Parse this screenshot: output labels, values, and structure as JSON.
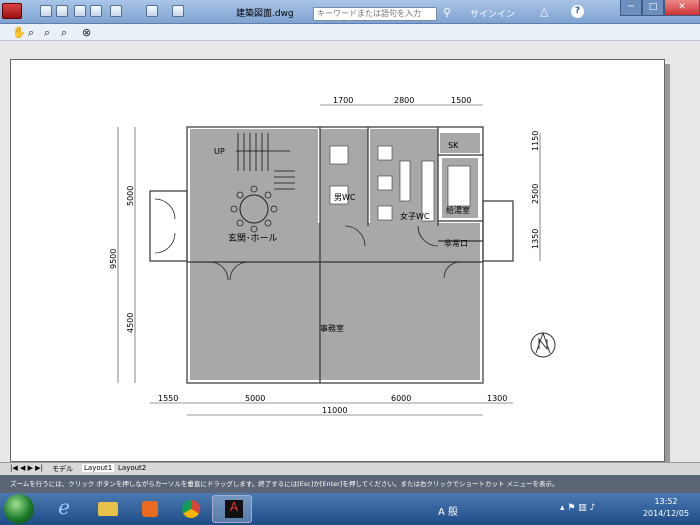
{
  "title_bar": {
    "file_name": "建築図面.dwg",
    "search_placeholder": "キーワードまたは語句を入力",
    "signin": "サインイン"
  },
  "toolbar_icons": [
    "pan-icon",
    "zoom-realtime-icon",
    "zoom-window-icon",
    "zoom-previous-icon",
    "close-icon"
  ],
  "layout_tabs": [
    "モデル",
    "Layout1",
    "Layout2"
  ],
  "command_line": "ズームを行うには、クリック ボタンを押しながらカーソルを垂直にドラッグします。終了するには[Esc]か[Enter]を押してください。または右クリックでショートカット メニューを表示。",
  "drawing": {
    "top_dims": [
      "1700",
      "2800",
      "1500"
    ],
    "bottom_dims": [
      "1550",
      "5000",
      "6000",
      "1300"
    ],
    "total_width": "11000",
    "left_dims": [
      "5000",
      "9500",
      "4500"
    ],
    "right_dims": [
      "1150",
      "2500",
      "1350"
    ],
    "rooms": {
      "up": "UP",
      "hall": "玄関･ホール",
      "mens_wc": "男WC",
      "womens_wc": "女子WC",
      "kitchenette": "給湯室",
      "sk": "SK",
      "emergency_exit": "非常口",
      "office": "事務室"
    }
  },
  "taskbar": {
    "ime": "A 般",
    "time": "13:52",
    "date": "2014/12/05"
  }
}
